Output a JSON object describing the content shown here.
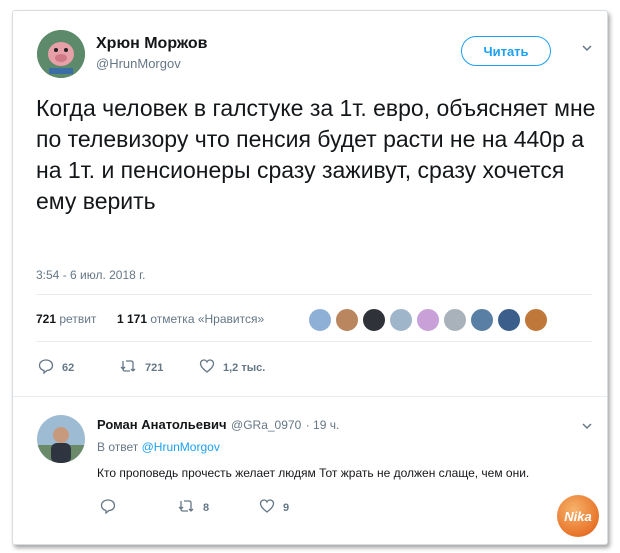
{
  "tweet": {
    "author_name": "Хрюн Моржов",
    "author_handle": "@HrunMorgov",
    "follow_label": "Читать",
    "text": "Когда человек в галстуке за 1т. евро, объясняет мне по телевизору что пенсия будет расти не на 440р а на 1т. и пенсионеры сразу заживут, сразу хочется ему верить",
    "timestamp": "3:54 - 6 июл. 2018 г.",
    "retweets_count": "721",
    "retweets_label": "ретвит",
    "likes_count": "1 171",
    "likes_label": "отметка «Нравится»",
    "actions": {
      "replies": "62",
      "retweets": "721",
      "likes": "1,2 тыс."
    }
  },
  "reply": {
    "author_name": "Роман Анатольевич",
    "author_handle": "@GRa_0970",
    "time": "· 19 ч.",
    "reply_to_prefix": "В ответ",
    "reply_to_handle": "@HrunMorgov",
    "text": "Кто проповедь прочесть желает людям Тот жрать не должен слаще, чем они.",
    "actions": {
      "replies": "",
      "retweets": "8",
      "likes": "9"
    }
  },
  "watermark": {
    "text": "Nika"
  },
  "colors": {
    "accent": "#1da1f2",
    "muted": "#657786",
    "text": "#14171a"
  },
  "liker_colors": [
    "#8fb0d6",
    "#b9865f",
    "#2f3238",
    "#9fb5c9",
    "#c9a0d8",
    "#a9b2bb",
    "#5a7fa4",
    "#3b5f8a",
    "#c0783a"
  ]
}
